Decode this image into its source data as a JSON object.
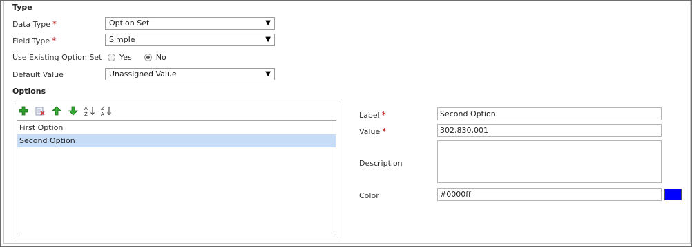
{
  "type_section": {
    "title": "Type"
  },
  "form": {
    "data_type": {
      "label": "Data Type",
      "required": "*",
      "value": "Option Set",
      "arrow": "▼"
    },
    "field_type": {
      "label": "Field Type",
      "required": "*",
      "value": "Simple",
      "arrow": "▼"
    },
    "use_existing": {
      "label": "Use Existing Option Set",
      "options": [
        {
          "label": "Yes",
          "checked": false
        },
        {
          "label": "No",
          "checked": true
        }
      ]
    },
    "default_value": {
      "label": "Default Value",
      "value": "Unassigned Value",
      "arrow": "▼"
    }
  },
  "options_section": {
    "title": "Options",
    "toolbar": {
      "icons": [
        "add-icon",
        "delete-icon",
        "move-up-icon",
        "move-down-icon",
        "sort-ascending-icon",
        "sort-descending-icon"
      ]
    },
    "items": [
      {
        "label": "First Option",
        "selected": false
      },
      {
        "label": "Second Option",
        "selected": true
      }
    ]
  },
  "detail": {
    "label": {
      "label": "Label",
      "required": "*",
      "value": "Second Option"
    },
    "value": {
      "label": "Value",
      "required": "*",
      "value": "302,830,001"
    },
    "description": {
      "label": "Description",
      "value": ""
    },
    "color": {
      "label": "Color",
      "value": "#0000ff",
      "swatch": "#0000ff"
    }
  },
  "colors": {
    "selected_row": "#c7dcf6",
    "required_star": "#c00000",
    "add_green": "#2e9e2e",
    "delete_red": "#d23b3b"
  }
}
